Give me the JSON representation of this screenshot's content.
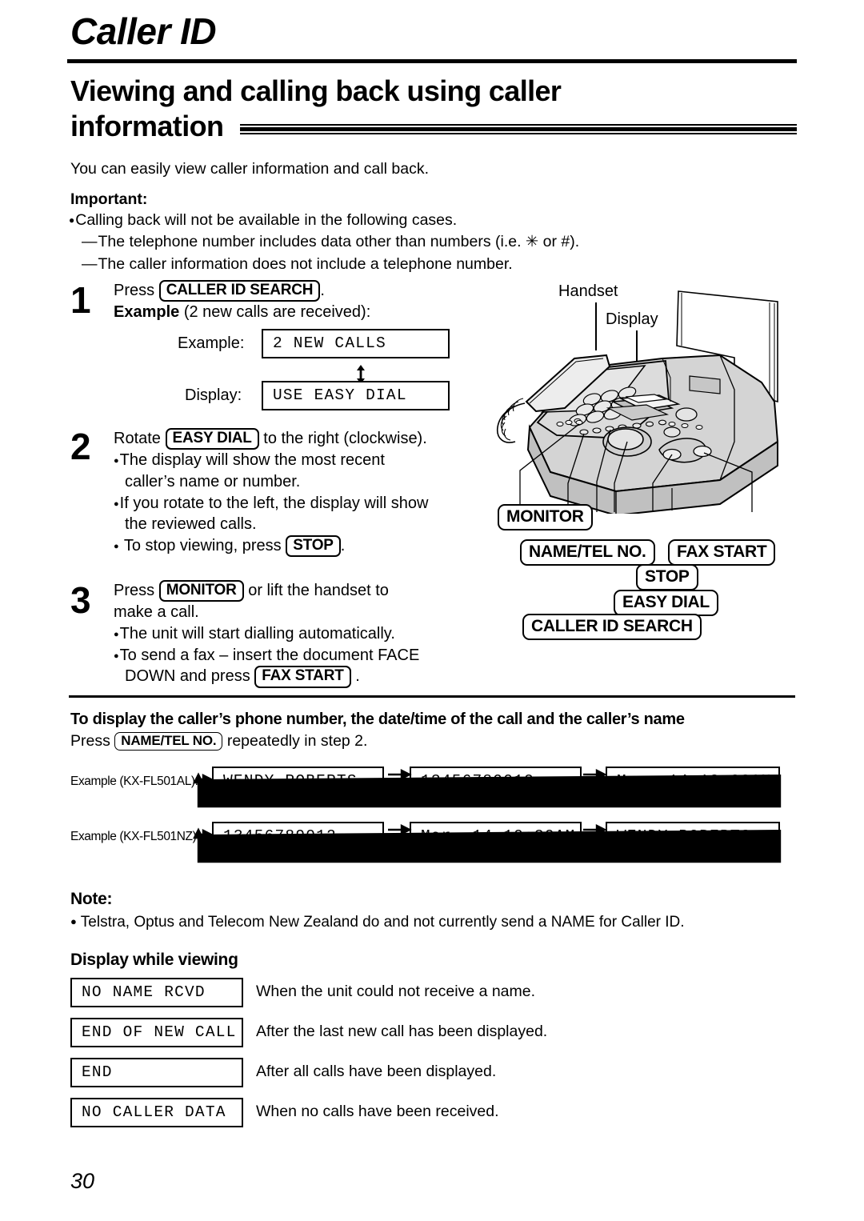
{
  "header": {
    "chapter": "Caller ID",
    "section_title": "Viewing and calling back using caller information",
    "intro": "You can easily view caller information and call back."
  },
  "important": {
    "label": "Important:",
    "bullet": "Calling back will not be available in the following cases.",
    "sub1": "The telephone number includes data other than numbers (i.e. ✳ or #).",
    "sub2": "The caller information does not include a telephone number."
  },
  "steps": [
    {
      "number": "1",
      "line1_pre": "Press",
      "line1_key": "CALLER ID SEARCH",
      "line1_post": ".",
      "line2_bold": "Example",
      "line2_rest": "(2 new calls are received):",
      "example_label": "Example:",
      "example_value": "2 NEW CALLS",
      "display_label": "Display:",
      "display_value": "USE EASY DIAL"
    },
    {
      "number": "2",
      "line1_pre": "Rotate",
      "line1_key": "EASY DIAL",
      "line1_post": "to the right (clockwise).",
      "b1_a": "The display will show the most recent",
      "b1_b": "caller’s name or number.",
      "b2_a": "If you rotate to the left, the display will show",
      "b2_b": "the reviewed calls.",
      "b3_pre": "To stop viewing, press",
      "b3_key": "STOP",
      "b3_post": "."
    },
    {
      "number": "3",
      "line1_pre": "Press",
      "line1_key": "MONITOR",
      "line1_post": "or lift the handset to",
      "line2": "make a call.",
      "b1": "The unit will start dialling automatically.",
      "b2_a": "To send a fax – insert the document FACE",
      "b2_b_pre": "DOWN and press",
      "b2_b_key": "FAX START",
      "b2_b_post": "."
    }
  ],
  "illustration": {
    "handset_label": "Handset",
    "display_label": "Display",
    "callouts": [
      "MONITOR",
      "NAME/TEL NO.",
      "FAX START",
      "STOP",
      "EASY DIAL",
      "CALLER ID SEARCH"
    ]
  },
  "display_section": {
    "heading": "To display the caller’s phone number, the date/time of the call and the caller’s name",
    "instr_pre": "Press",
    "instr_key": "NAME/TEL NO.",
    "instr_post": "repeatedly in step 2.",
    "flows": [
      {
        "label": "Example (KX-FL501AL):",
        "items": [
          "WENDY ROBERTS",
          "13456789012",
          "Mar. 14 10:30AM"
        ]
      },
      {
        "label": "Example (KX-FL501NZ):",
        "items": [
          "13456789012",
          "Mar. 14 10:30AM",
          "WENDY ROBERTS"
        ]
      }
    ]
  },
  "note": {
    "label": "Note:",
    "text": "Telstra, Optus and Telecom New Zealand do and not currently send a NAME for Caller ID."
  },
  "viewing": {
    "heading": "Display while viewing",
    "rows": [
      {
        "display": "NO NAME RCVD",
        "desc": "When the unit could not receive a name."
      },
      {
        "display": "END OF NEW CALL",
        "desc": "After the last new call has been displayed."
      },
      {
        "display": "END",
        "desc": "After all calls have been displayed."
      },
      {
        "display": "NO CALLER DATA",
        "desc": "When no calls have been received."
      }
    ]
  },
  "footer": {
    "page_number": "30"
  }
}
